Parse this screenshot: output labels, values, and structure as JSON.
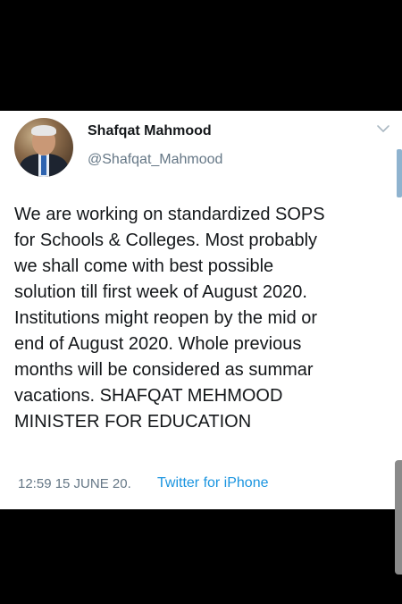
{
  "tweet": {
    "author_name": "Shafqat Mahmood",
    "author_handle": "@Shafqat_Mahmood",
    "text_lines": [
      "We are working on standardized SOPS",
      "for Schools & Colleges. Most probably",
      "we shall come with best possible",
      "solution till first week of August 2020.",
      "Institutions might reopen by the mid or",
      "end of August 2020. Whole previous",
      "months will be considered as summar",
      "vacations. SHAFQAT MEHMOOD",
      "MINISTER FOR EDUCATION"
    ],
    "timestamp": "12:59 15 JUNE 20.",
    "source": "Twitter for iPhone"
  },
  "colors": {
    "text": "#14171a",
    "secondary": "#657786",
    "link": "#1b95e0",
    "background": "#ffffff"
  },
  "icons": {
    "menu": "chevron-down-icon"
  }
}
